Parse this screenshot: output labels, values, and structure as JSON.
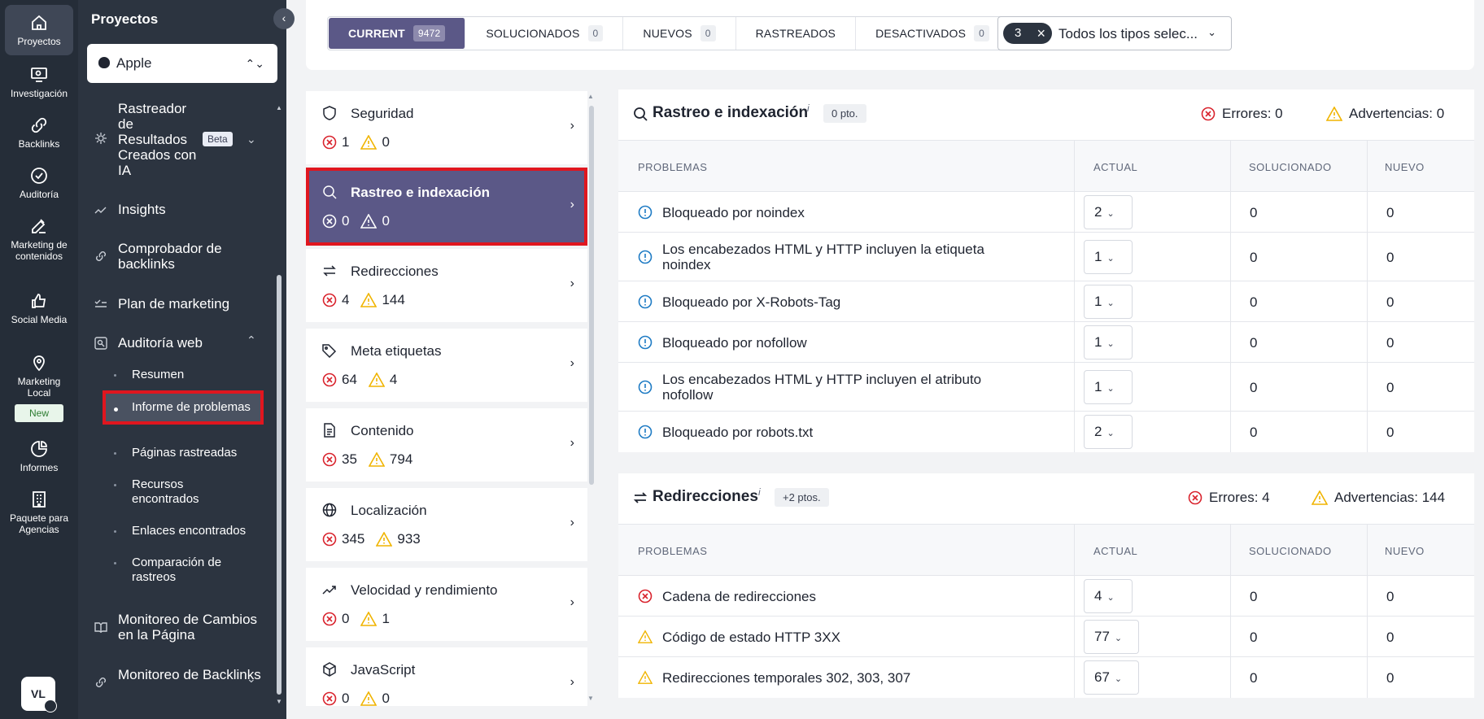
{
  "rail": {
    "items": [
      {
        "label": "Proyectos",
        "icon": "home-icon"
      },
      {
        "label": "Investigación",
        "icon": "monitor-search-icon"
      },
      {
        "label": "Backlinks",
        "icon": "link-icon"
      },
      {
        "label": "Auditoría",
        "icon": "check-circle-icon"
      },
      {
        "label": "Marketing de contenidos",
        "icon": "edit-icon"
      },
      {
        "label": "Social Media",
        "icon": "thumbs-up-icon"
      },
      {
        "label": "Marketing Local",
        "icon": "location-pin-icon"
      },
      {
        "label": "Informes",
        "icon": "pie-chart-icon"
      },
      {
        "label": "Paquete para Agencias",
        "icon": "building-icon"
      }
    ],
    "new_badge": "New",
    "avatar": "VL"
  },
  "sidebar": {
    "title": "Proyectos",
    "project": "Apple",
    "items": {
      "ai_tracker": "Rastreador de Resultados Creados con IA",
      "beta": "Beta",
      "insights": "Insights",
      "backlink_checker": "Comprobador de backlinks",
      "marketing_plan": "Plan de marketing",
      "web_audit": "Auditoría web",
      "page_changes": "Monitoreo de Cambios en la Página",
      "backlink_monitor": "Monitoreo de Backlinks"
    },
    "sub_items": {
      "summary": "Resumen",
      "issues_report": "Informe de problemas",
      "crawled_pages": "Páginas rastreadas",
      "resources_found": "Recursos encontrados",
      "links_found": "Enlaces encontrados",
      "crawl_comparison": "Comparación de rastreos"
    }
  },
  "topbar": {
    "tabs": [
      {
        "label": "CURRENT",
        "count": "9472"
      },
      {
        "label": "SOLUCIONADOS",
        "count": "0"
      },
      {
        "label": "NUEVOS",
        "count": "0"
      },
      {
        "label": "RASTREADOS",
        "count": ""
      },
      {
        "label": "DESACTIVADOS",
        "count": "0"
      }
    ],
    "type_filter": {
      "count": "3",
      "text": "Todos los tipos selec..."
    }
  },
  "categories": [
    {
      "name": "Seguridad",
      "errors": "1",
      "warnings": "0",
      "icon": "shield-icon"
    },
    {
      "name": "Rastreo e indexación",
      "errors": "0",
      "warnings": "0",
      "icon": "search-icon"
    },
    {
      "name": "Redirecciones",
      "errors": "4",
      "warnings": "144",
      "icon": "redirect-icon"
    },
    {
      "name": "Meta etiquetas",
      "errors": "64",
      "warnings": "4",
      "icon": "tag-icon"
    },
    {
      "name": "Contenido",
      "errors": "35",
      "warnings": "794",
      "icon": "document-icon"
    },
    {
      "name": "Localización",
      "errors": "345",
      "warnings": "933",
      "icon": "globe-icon"
    },
    {
      "name": "Velocidad y rendimiento",
      "errors": "0",
      "warnings": "1",
      "icon": "trend-up-icon"
    },
    {
      "name": "JavaScript",
      "errors": "0",
      "warnings": "0",
      "icon": "code-cube-icon"
    }
  ],
  "panels": {
    "crawl": {
      "title": "Rastreo e indexación",
      "info": "i",
      "points": "0 pto.",
      "errors_label": "Errores: 0",
      "warnings_label": "Advertencias: 0",
      "headers": {
        "problems": "PROBLEMAS",
        "current": "ACTUAL",
        "solved": "SOLUCIONADO",
        "new": "NUEVO"
      },
      "rows": [
        {
          "text": "Bloqueado por noindex",
          "current": "2",
          "solved": "0",
          "new": "0",
          "type": "info"
        },
        {
          "text": "Los encabezados HTML y HTTP incluyen la etiqueta noindex",
          "current": "1",
          "solved": "0",
          "new": "0",
          "type": "info"
        },
        {
          "text": "Bloqueado por X-Robots-Tag",
          "current": "1",
          "solved": "0",
          "new": "0",
          "type": "info"
        },
        {
          "text": "Bloqueado por nofollow",
          "current": "1",
          "solved": "0",
          "new": "0",
          "type": "info"
        },
        {
          "text": "Los encabezados HTML y HTTP incluyen el atributo nofollow",
          "current": "1",
          "solved": "0",
          "new": "0",
          "type": "info"
        },
        {
          "text": "Bloqueado por robots.txt",
          "current": "2",
          "solved": "0",
          "new": "0",
          "type": "info"
        }
      ]
    },
    "redirects": {
      "title": "Redirecciones",
      "info": "i",
      "points": "+2 ptos.",
      "errors_label": "Errores: 4",
      "warnings_label": "Advertencias: 144",
      "headers": {
        "problems": "PROBLEMAS",
        "current": "ACTUAL",
        "solved": "SOLUCIONADO",
        "new": "NUEVO"
      },
      "rows": [
        {
          "text": "Cadena de redirecciones",
          "current": "4",
          "solved": "0",
          "new": "0",
          "type": "error"
        },
        {
          "text": "Código de estado HTTP 3XX",
          "current": "77",
          "solved": "0",
          "new": "0",
          "type": "warning"
        },
        {
          "text": "Redirecciones temporales 302, 303, 307",
          "current": "67",
          "solved": "0",
          "new": "0",
          "type": "warning"
        }
      ]
    }
  },
  "colors": {
    "accent": "#5b5887",
    "error": "#d9232d",
    "warning": "#f0b400",
    "info": "#1e7bc4",
    "highlight": "#e0161f"
  }
}
